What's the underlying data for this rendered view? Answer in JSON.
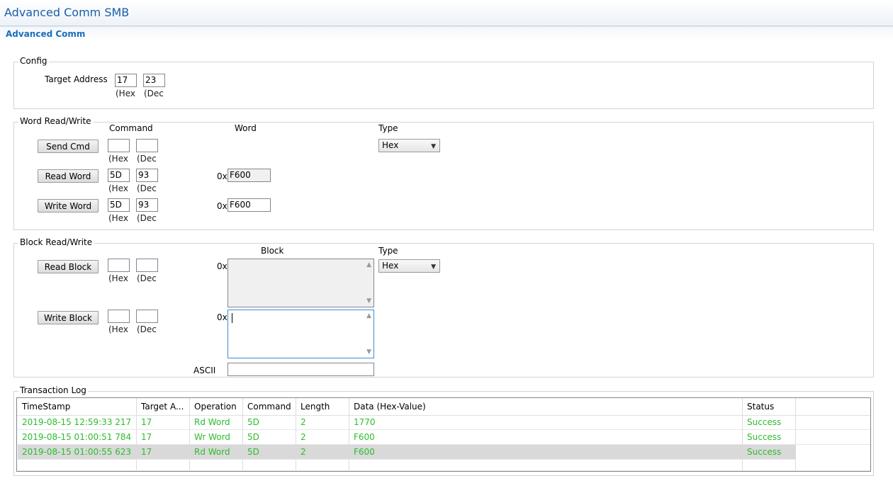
{
  "app": {
    "title": "Advanced Comm SMB"
  },
  "tab": {
    "label": "Advanced Comm"
  },
  "config": {
    "legend": "Config",
    "target_label": "Target Address",
    "target_hex": "17",
    "target_dec": "23",
    "hex_unit": "(Hex",
    "dec_unit": "(Dec"
  },
  "word": {
    "legend": "Word Read/Write",
    "col_command": "Command",
    "col_word": "Word",
    "col_type": "Type",
    "type_value": "Hex",
    "prefix": "0x",
    "hex_unit": "(Hex",
    "dec_unit": "(Dec",
    "send_cmd": {
      "label": "Send Cmd",
      "hex": "",
      "dec": ""
    },
    "read_word": {
      "label": "Read Word",
      "hex": "5D",
      "dec": "93",
      "value": "F600"
    },
    "write_word": {
      "label": "Write Word",
      "hex": "5D",
      "dec": "93",
      "value": "F600"
    }
  },
  "block": {
    "legend": "Block Read/Write",
    "col_block": "Block",
    "col_type": "Type",
    "type_value": "Hex",
    "prefix": "0x",
    "hex_unit": "(Hex",
    "dec_unit": "(Dec",
    "ascii_label": "ASCII",
    "read_block": {
      "label": "Read Block",
      "hex": "",
      "dec": ""
    },
    "write_block": {
      "label": "Write Block",
      "hex": "",
      "dec": ""
    }
  },
  "log": {
    "legend": "Transaction Log",
    "columns": [
      "TimeStamp",
      "Target A...",
      "Operation",
      "Command",
      "Length",
      "Data (Hex-Value)",
      "Status"
    ],
    "rows": [
      [
        "2019-08-15 12:59:33 217",
        "17",
        "Rd Word",
        "5D",
        "2",
        "1770",
        "Success"
      ],
      [
        "2019-08-15 01:00:51 784",
        "17",
        "Wr Word",
        "5D",
        "2",
        "F600",
        "Success"
      ],
      [
        "2019-08-15 01:00:55 623",
        "17",
        "Rd Word",
        "5D",
        "2",
        "F600",
        "Success"
      ]
    ],
    "selected_row": 2,
    "row_text_color": "#2bbd2b"
  },
  "icons": {
    "dropdown": "chevron-down-icon",
    "scroll_up": "scroll-up-icon",
    "scroll_down": "scroll-down-icon"
  }
}
